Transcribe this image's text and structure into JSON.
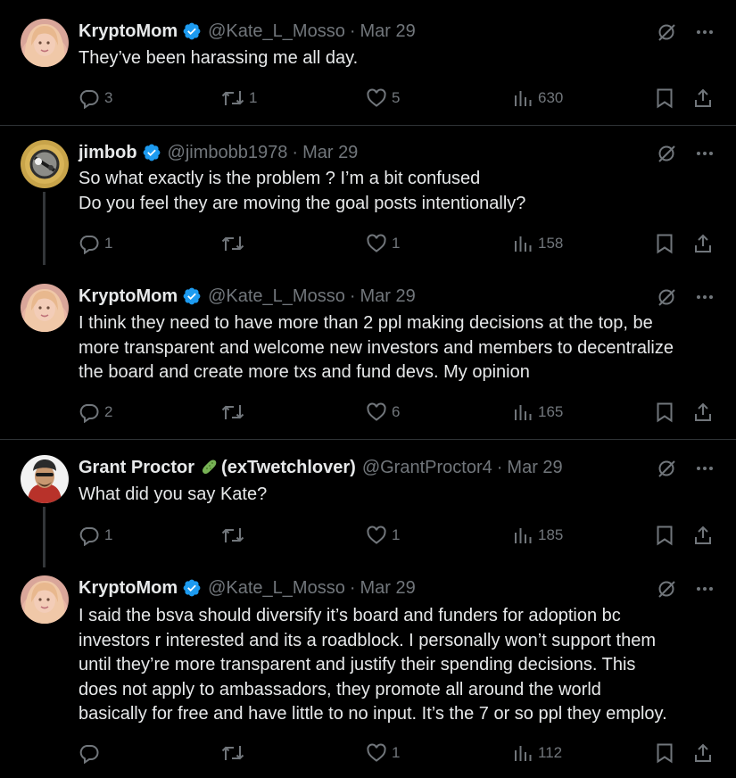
{
  "tweets": [
    {
      "name": "KryptoMom",
      "handle": "@Kate_L_Mosso",
      "dot": "·",
      "date": "Mar 29",
      "lines": [
        "They’ve been harassing me all day."
      ],
      "replies": "3",
      "retweets": "1",
      "likes": "5",
      "views": "630"
    },
    {
      "name": "jimbob",
      "handle": "@jimbobb1978",
      "dot": "·",
      "date": "Mar 29",
      "lines": [
        "So what exactly is the problem ? I’m a bit confused",
        "Do you feel they are moving the goal posts intentionally?"
      ],
      "replies": "1",
      "retweets": "",
      "likes": "1",
      "views": "158"
    },
    {
      "name": "KryptoMom",
      "handle": "@Kate_L_Mosso",
      "dot": "·",
      "date": "Mar 29",
      "lines": [
        "I think they need to have more than 2 ppl making decisions at the top, be",
        "more transparent and welcome new investors and members to decentralize",
        "the board and create more txs and fund devs. My opinion"
      ],
      "replies": "2",
      "retweets": "",
      "likes": "6",
      "views": "165"
    },
    {
      "name_pre": "Grant Proctor",
      "name_post": "(exTwetchlover)",
      "handle": "@GrantProctor4",
      "dot": "·",
      "date": "Mar 29",
      "lines": [
        "What did you say Kate?"
      ],
      "replies": "1",
      "retweets": "",
      "likes": "1",
      "views": "185"
    },
    {
      "name": "KryptoMom",
      "handle": "@Kate_L_Mosso",
      "dot": "·",
      "date": "Mar 29",
      "lines": [
        "I said the bsva should diversify it’s board and funders for adoption bc",
        "investors r interested and its a roadblock. I personally won’t support them",
        "until they’re more transparent and justify their spending decisions. This",
        "does not apply to ambassadors, they promote all around the world",
        "basically for free and have little to no input. It’s the 7 or so ppl they employ."
      ],
      "replies": "",
      "retweets": "",
      "likes": "1",
      "views": "112"
    }
  ],
  "colors": {
    "background": "#000000",
    "text": "#e7e9ea",
    "muted": "#71767b",
    "verified": "#1d9bf0",
    "separator": "#2f3336"
  },
  "icons": {
    "reply": "reply-icon",
    "retweet": "retweet-icon",
    "like": "like-icon",
    "views": "views-icon",
    "bookmark": "bookmark-icon",
    "share": "share-icon",
    "grok": "grok-icon",
    "more": "more-icon",
    "verified": "verified-badge-icon",
    "pickle": "pickle-emoji-icon"
  }
}
